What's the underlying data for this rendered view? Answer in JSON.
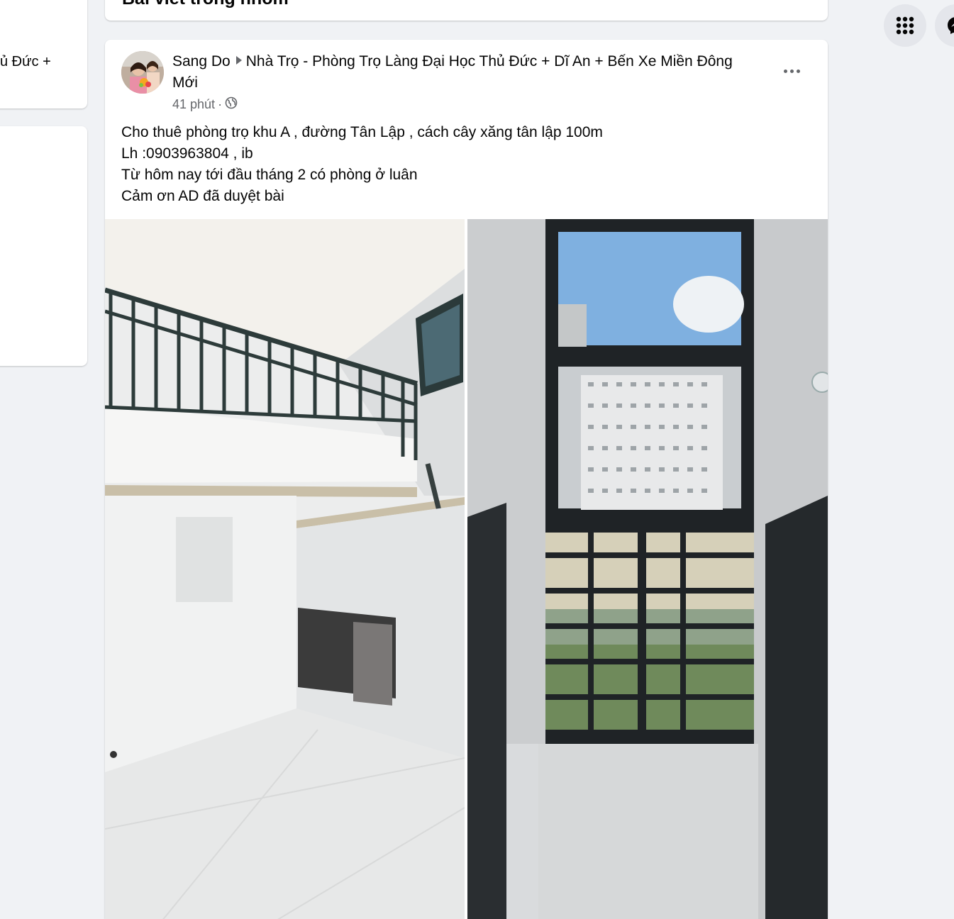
{
  "left_sidebar": {
    "card_fragment_text": "ủ Đức +"
  },
  "top_card": {
    "heading": "Bài viết trong nhóm"
  },
  "post": {
    "author": "Sang Do",
    "group": "Nhà Trọ - Phòng Trọ Làng Đại Học Thủ Đức + Dĩ An + Bến Xe Miền Đông Mới",
    "time": "41 phút",
    "separator": " · ",
    "privacy_icon": "globe-icon",
    "more_icon": "more-options-icon",
    "text_lines": [
      "Cho thuê phòng trọ khu A , đường Tân Lập , cách cây xăng tân lập 100m",
      "Lh :0903963804 , ib",
      "Từ hôm nay tới đầu tháng 2 có phòng ở luân",
      "Cảm ơn AD đã duyệt bài"
    ],
    "photos": [
      "room-loft-photo",
      "room-window-photo"
    ]
  },
  "right_header": {
    "menu_icon": "grid-menu-icon",
    "messenger_icon": "messenger-icon"
  },
  "colors": {
    "page_background": "#f0f2f5",
    "card_background": "#ffffff",
    "primary_text": "#050505",
    "secondary_text": "#65676b",
    "button_background": "#e4e6eb"
  }
}
